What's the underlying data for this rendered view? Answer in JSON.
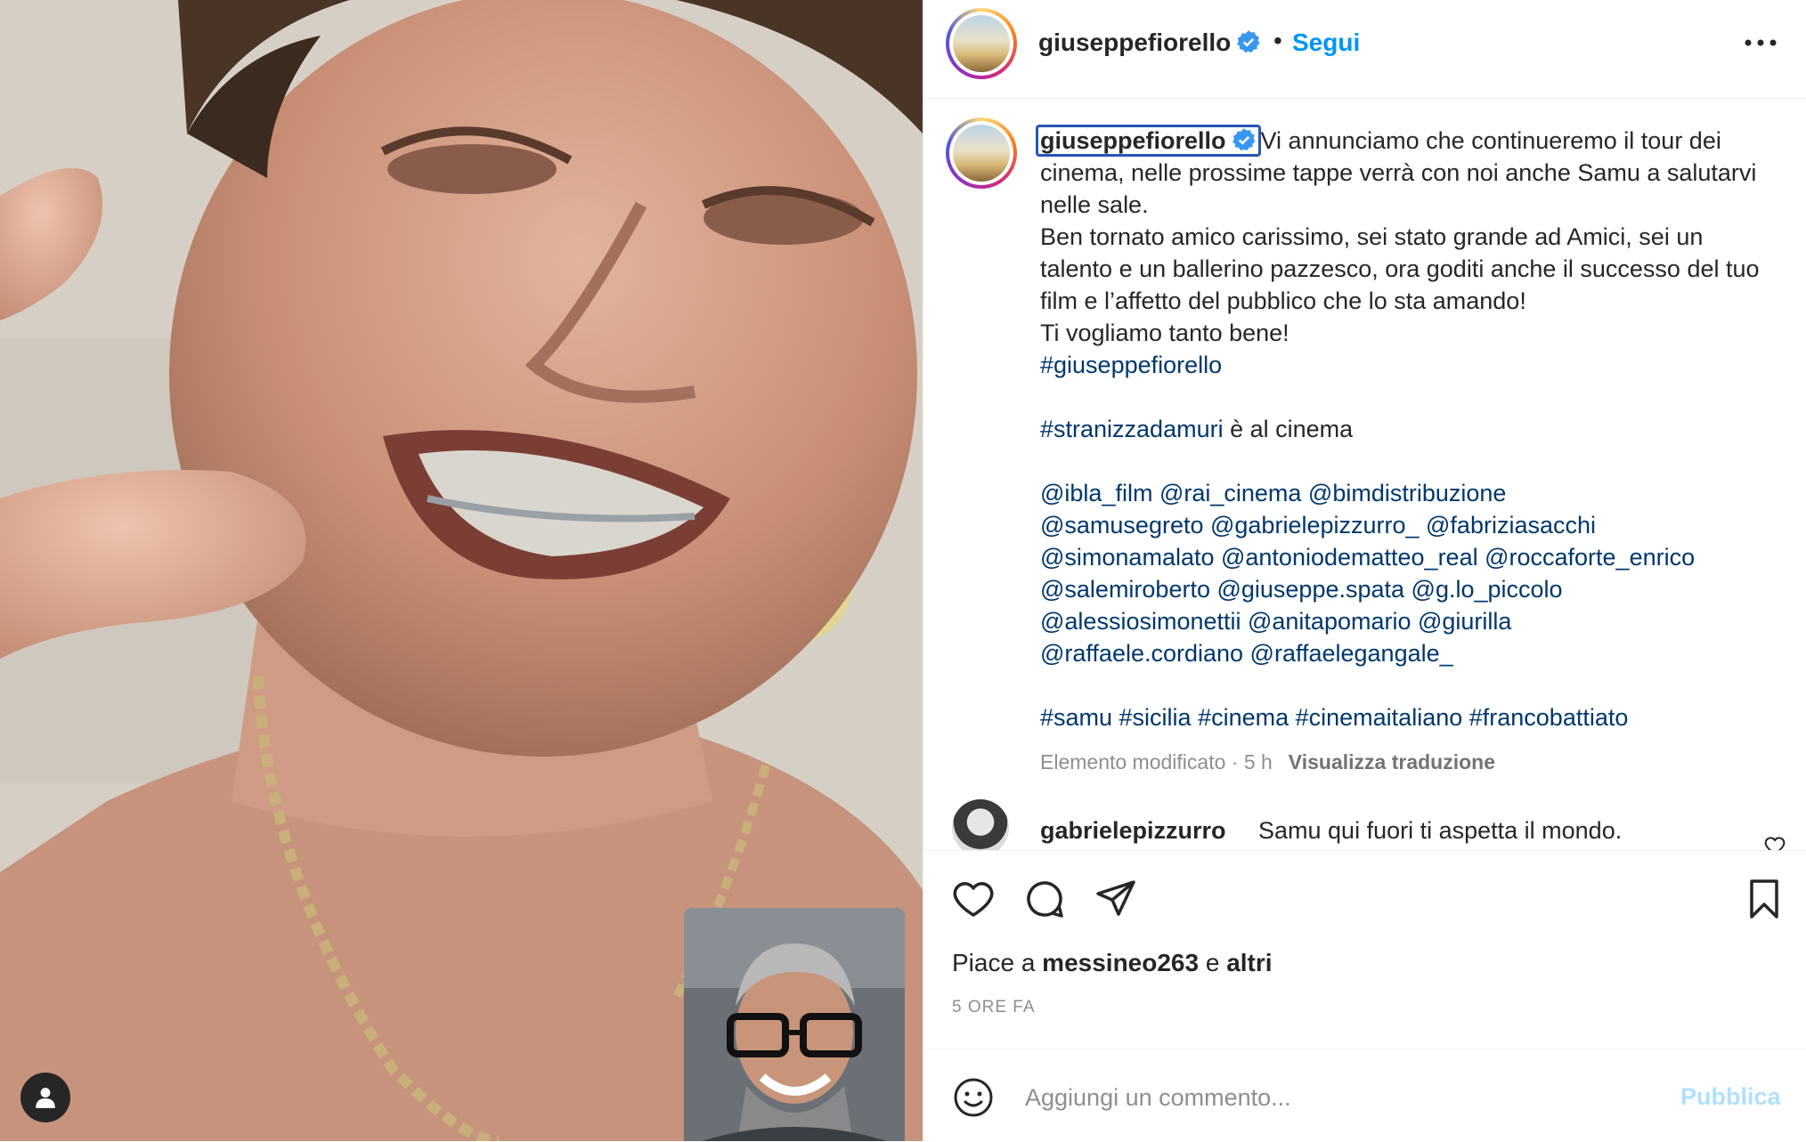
{
  "header": {
    "username": "giuseppefiorello",
    "separator": "•",
    "follow_label": "Segui",
    "more_icon": "more-horizontal-icon"
  },
  "caption": {
    "username": "giuseppefiorello",
    "intro": "Vi annunciamo che continueremo il tour dei cinema, nelle prossime tappe verrà con noi anche Samu a salutarvi nelle sale.",
    "body": "Ben tornato amico carissimo, sei stato grande ad Amici, sei un talento e un ballerino pazzesco, ora goditi anche il successo del tuo film e l’affetto del pubblico che lo sta amando!",
    "closing": "Ti vogliamo tanto bene!",
    "hashtag1": "#giuseppefiorello",
    "hashtag2": "#stranizzadamuri",
    "hashtag2_suffix": " è al cinema",
    "mentions": [
      "@ibla_film @rai_cinema @bimdistribuzione",
      "@samusegreto @gabrielepizzurro_ @fabriziasacchi",
      "@simonamalato @antoniodematteo_real @roccaforte_enrico",
      "@salemiroberto @giuseppe.spata @g.lo_piccolo",
      "@alessiosimonettii @anitapomario @giurilla",
      "@raffaele.cordiano @raffaelegangale_"
    ],
    "tags_line": "#samu #sicilia #cinema #cinemaitaliano #francobattiato",
    "edited": "Elemento modificato · 5 h",
    "translate": "Visualizza traduzione"
  },
  "comment": {
    "username": "gabrielepizzurro",
    "text": "Samu qui fuori ti aspetta il mondo."
  },
  "likes": {
    "prefix": "Piace a ",
    "user": "messineo263",
    "middle": " e ",
    "others": "altri"
  },
  "time_ago": "5 ORE FA",
  "add_comment": {
    "placeholder": "Aggiungi un commento...",
    "publish": "Pubblica"
  },
  "colors": {
    "link": "#00376b",
    "follow": "#0095f6",
    "publish_disabled": "#b2dffc",
    "verified": "#3897f0"
  }
}
